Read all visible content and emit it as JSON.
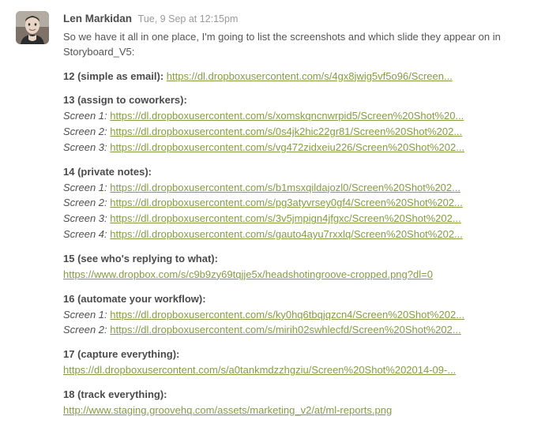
{
  "author": "Len Markidan",
  "timestamp": "Tue, 9 Sep at 12:15pm",
  "intro": "So we have it all in one place, I'm going to list the screenshots and which slide they appear on in Storyboard_V5:",
  "sections": [
    {
      "title": "12 (simple as email):",
      "inline_link": "https://dl.dropboxusercontent.com/s/4gx8jwig5vf5o96/Screen...",
      "lines": []
    },
    {
      "title": "13 (assign to coworkers):",
      "lines": [
        {
          "label": "Screen 1:",
          "url": "https://dl.dropboxusercontent.com/s/xomskqncnwrpid5/Screen%20Shot%20..."
        },
        {
          "label": "Screen 2:",
          "url": "https://dl.dropboxusercontent.com/s/0s4jk2hic22gr81/Screen%20Shot%202..."
        },
        {
          "label": "Screen 3:",
          "url": "https://dl.dropboxusercontent.com/s/vg472zidxeiu226/Screen%20Shot%202..."
        }
      ]
    },
    {
      "title": "14 (private notes):",
      "lines": [
        {
          "label": "Screen 1:",
          "url": "https://dl.dropboxusercontent.com/s/b1msxqildajozl0/Screen%20Shot%202..."
        },
        {
          "label": "Screen 2:",
          "url": "https://dl.dropboxusercontent.com/s/pg3atyvrsey0gf4/Screen%20Shot%202..."
        },
        {
          "label": "Screen 3:",
          "url": "https://dl.dropboxusercontent.com/s/3v5jmpign4jfgxc/Screen%20Shot%202..."
        },
        {
          "label": "Screen 4:",
          "url": "https://dl.dropboxusercontent.com/s/gauto4ayu7rxxlq/Screen%20Shot%202..."
        }
      ]
    },
    {
      "title": "15 (see who's replying to what):",
      "lines": [
        {
          "label": "",
          "url": "https://www.dropbox.com/s/c9b9zy69tqjje5x/headshotingroove-cropped.png?dl=0"
        }
      ]
    },
    {
      "title": "16 (automate your workflow):",
      "lines": [
        {
          "label": "Screen 1:",
          "url": "https://dl.dropboxusercontent.com/s/ky0hq6tbqjqzcn4/Screen%20Shot%202..."
        },
        {
          "label": "Screen 2:",
          "url": "https://dl.dropboxusercontent.com/s/mirih02swhlecfd/Screen%20Shot%202..."
        }
      ]
    },
    {
      "title": "17 (capture everything):",
      "lines": [
        {
          "label": "",
          "url": "https://dl.dropboxusercontent.com/s/a0tankmdzzhgziu/Screen%20Shot%202014-09-..."
        }
      ]
    },
    {
      "title": "18 (track everything):",
      "lines": [
        {
          "label": "",
          "url": "http://www.staging.groovehq.com/assets/marketing_v2/at/ml-reports.png"
        }
      ]
    }
  ]
}
